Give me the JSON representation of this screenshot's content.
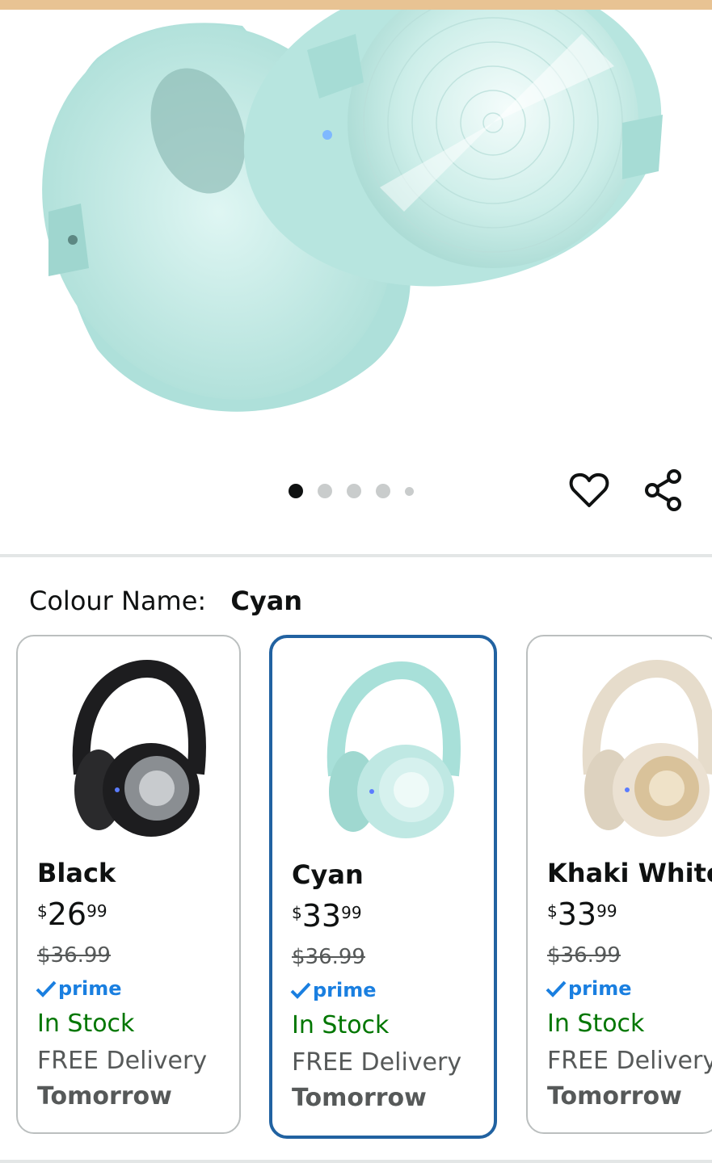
{
  "hero": {
    "image_alt": "headphones-product-image",
    "carousel_dots": 5,
    "active_dot": 0
  },
  "actions": {
    "wishlist_icon": "heart-outline-icon",
    "share_icon": "share-icon"
  },
  "colour": {
    "label": "Colour Name:",
    "value": "Cyan"
  },
  "swatches": [
    {
      "name": "Black",
      "currency": "$",
      "whole": "26",
      "fraction": "99",
      "was": "$36.99",
      "prime": "prime",
      "stock": "In Stock",
      "delivery": "FREE Delivery",
      "when": "Tomorrow",
      "color": "#1d1d1f",
      "selected": false
    },
    {
      "name": "Cyan",
      "currency": "$",
      "whole": "33",
      "fraction": "99",
      "was": "$36.99",
      "prime": "prime",
      "stock": "In Stock",
      "delivery": "FREE Delivery",
      "when": "Tomorrow",
      "color": "#bfe8e3",
      "selected": true
    },
    {
      "name": "Khaki White",
      "currency": "$",
      "whole": "33",
      "fraction": "99",
      "was": "$36.99",
      "prime": "prime",
      "stock": "In Stock",
      "delivery": "FREE Delivery",
      "when": "Tomorrow",
      "color": "#ebe1d2",
      "selected": false
    }
  ],
  "colors": {
    "accent_selected": "#2162a1",
    "in_stock": "#007600",
    "prime": "#1a7fe0"
  }
}
